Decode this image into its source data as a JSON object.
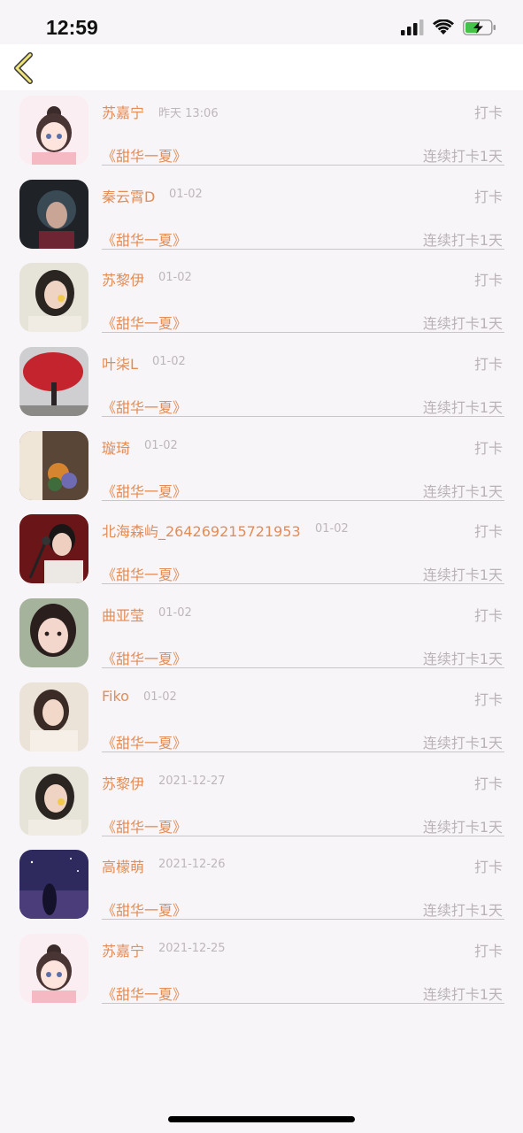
{
  "status_bar": {
    "time": "12:59"
  },
  "nav": {
    "back_icon": "chevron-left-icon"
  },
  "colors": {
    "accent": "#e38c55",
    "muted": "#b9b3b8",
    "background": "#f7f5f8"
  },
  "items": [
    {
      "name": "苏嘉宁",
      "date": "昨天 13:06",
      "action": "打卡",
      "book": "《甜华一夏》",
      "streak": "连续打卡1天",
      "avatar": "anime-girl-avatar"
    },
    {
      "name": "秦云霄D",
      "date": "01-02",
      "action": "打卡",
      "book": "《甜华一夏》",
      "streak": "连续打卡1天",
      "avatar": "photo-avatar-dark"
    },
    {
      "name": "苏黎伊",
      "date": "01-02",
      "action": "打卡",
      "book": "《甜华一夏》",
      "streak": "连续打卡1天",
      "avatar": "photo-avatar-woman"
    },
    {
      "name": "叶柒L",
      "date": "01-02",
      "action": "打卡",
      "book": "《甜华一夏》",
      "streak": "连续打卡1天",
      "avatar": "photo-avatar-red-tree"
    },
    {
      "name": "璇琦",
      "date": "01-02",
      "action": "打卡",
      "book": "《甜华一夏》",
      "streak": "连续打卡1天",
      "avatar": "photo-avatar-flowers"
    },
    {
      "name": "北海森屿_264269215721953",
      "date": "01-02",
      "action": "打卡",
      "book": "《甜华一夏》",
      "streak": "连续打卡1天",
      "avatar": "photo-avatar-singer"
    },
    {
      "name": "曲亚莹",
      "date": "01-02",
      "action": "打卡",
      "book": "《甜华一夏》",
      "streak": "连续打卡1天",
      "avatar": "photo-avatar-girl"
    },
    {
      "name": "Fiko",
      "date": "01-02",
      "action": "打卡",
      "book": "《甜华一夏》",
      "streak": "连续打卡1天",
      "avatar": "photo-avatar-woman-2"
    },
    {
      "name": "苏黎伊",
      "date": "2021-12-27",
      "action": "打卡",
      "book": "《甜华一夏》",
      "streak": "连续打卡1天",
      "avatar": "photo-avatar-woman"
    },
    {
      "name": "高檬萌",
      "date": "2021-12-26",
      "action": "打卡",
      "book": "《甜华一夏》",
      "streak": "连续打卡1天",
      "avatar": "photo-avatar-night-sky"
    },
    {
      "name": "苏嘉宁",
      "date": "2021-12-25",
      "action": "打卡",
      "book": "《甜华一夏》",
      "streak": "连续打卡1天",
      "avatar": "anime-girl-avatar"
    }
  ]
}
